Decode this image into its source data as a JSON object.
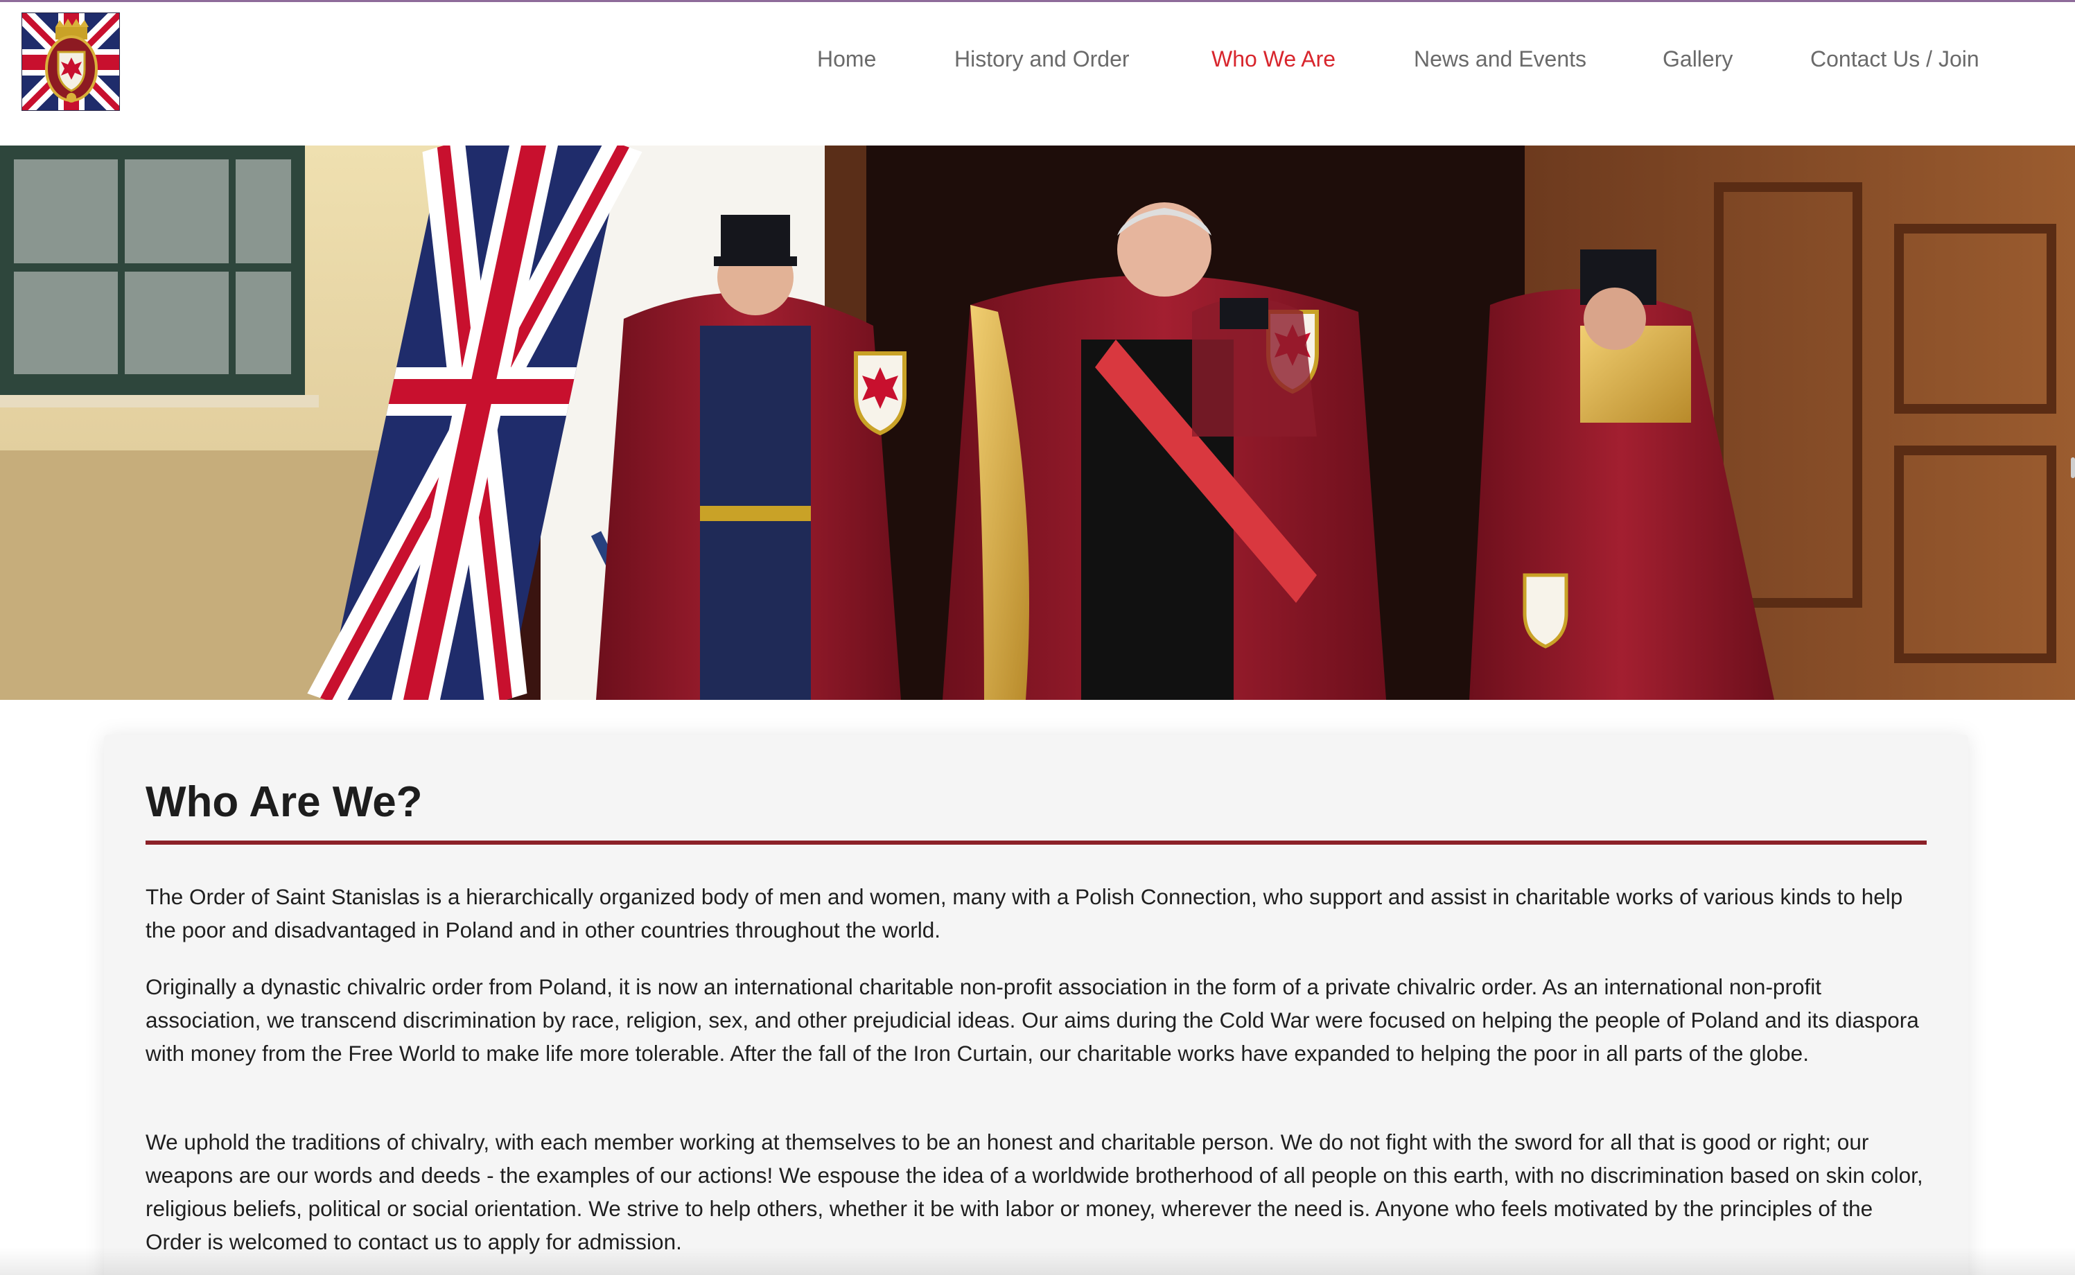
{
  "colors": {
    "accent_red": "#d8262d",
    "rule_maroon": "#8b2128",
    "nav_gray": "#6a6a6a",
    "card_bg": "#f5f5f5"
  },
  "header": {
    "logo_icon": "union-jack-coat-of-arms-logo",
    "nav": [
      {
        "label": "Home",
        "active": false
      },
      {
        "label": "History and Order",
        "active": false
      },
      {
        "label": "Who We Are",
        "active": true
      },
      {
        "label": "News and Events",
        "active": false
      },
      {
        "label": "Gallery",
        "active": false
      },
      {
        "label": "Contact Us / Join",
        "active": false
      }
    ]
  },
  "hero": {
    "image": "knights-in-red-capes-with-union-jack-flag-photo"
  },
  "main": {
    "title": "Who Are We?",
    "paragraphs": [
      "The Order of Saint Stanislas is a hierarchically organized body of men and women, many with a Polish Connection, who support and assist in charitable works of various kinds to help the poor and disadvantaged in Poland and in other countries throughout the world.",
      "Originally a dynastic chivalric order from Poland, it is now an international charitable non-profit association in the form of a private chivalric order. As an international non-profit association, we transcend discrimination by race, religion, sex, and other prejudicial ideas. Our aims during the Cold War were focused on helping the people of Poland and its diaspora with money from the Free World to make life more tolerable. After the fall of the Iron Curtain, our charitable works have expanded to helping the poor in all parts of the globe.",
      "We uphold the traditions of chivalry, with each member working at themselves to be an honest and charitable person. We do not fight with the sword for all that is good or right; our weapons are our words and deeds - the examples of our actions! We espouse the idea of a worldwide brotherhood of all people on this earth, with no discrimination based on skin color, religious beliefs, political or social orientation. We strive to help others, whether it be with labor or money, wherever the need is. Anyone who feels motivated by the principles of the Order is welcomed to contact us to apply for admission."
    ]
  }
}
